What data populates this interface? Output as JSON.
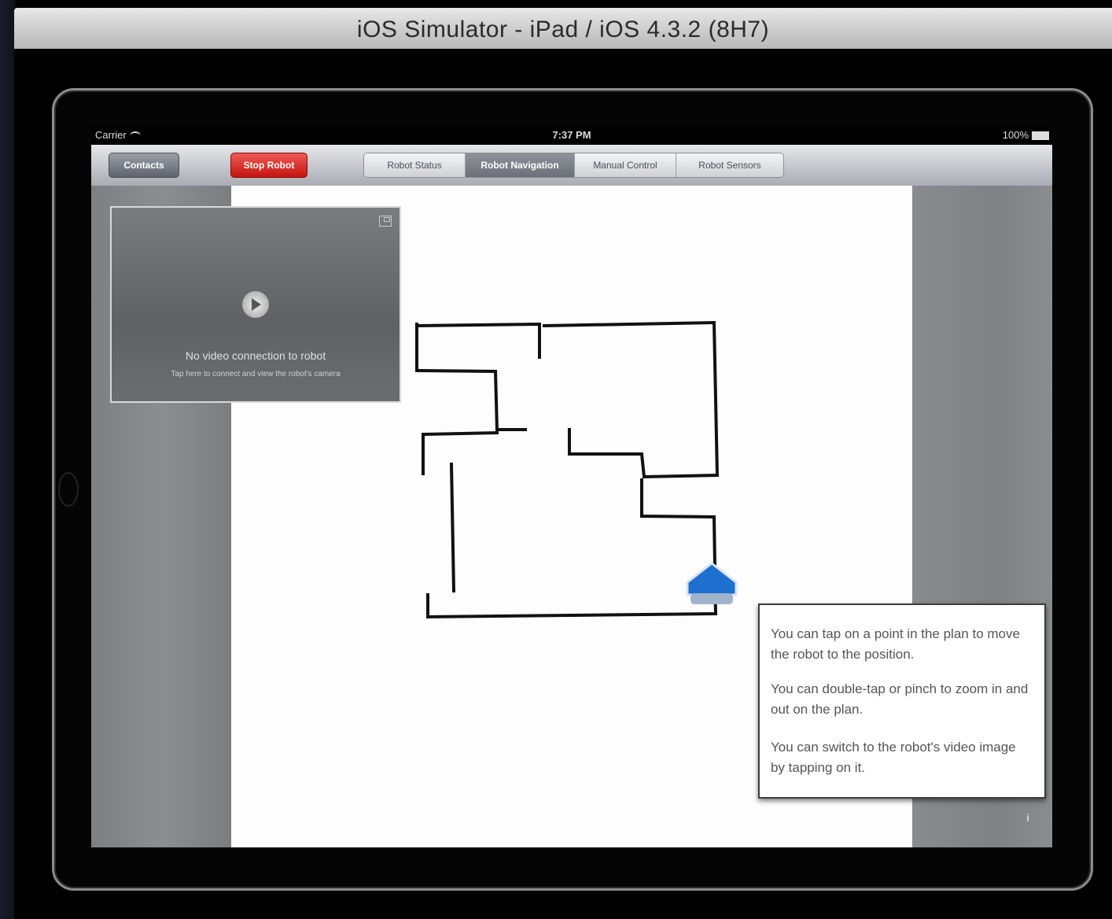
{
  "window": {
    "title": "iOS Simulator - iPad / iOS 4.3.2 (8H7)"
  },
  "statusbar": {
    "carrier": "Carrier",
    "time": "7:37 PM",
    "battery": "100%"
  },
  "navbar": {
    "contacts_label": "Contacts",
    "stop_label": "Stop Robot",
    "tabs": [
      {
        "label": "Robot Status",
        "active": false
      },
      {
        "label": "Robot Navigation",
        "active": true
      },
      {
        "label": "Manual Control",
        "active": false
      },
      {
        "label": "Robot Sensors",
        "active": false
      }
    ]
  },
  "video": {
    "message": "No video connection to robot",
    "hint": "Tap here to connect and view the robot's camera"
  },
  "help": {
    "p1": "You can tap on a point in the plan to move the robot to the position.",
    "p2": "You can double-tap or pinch to zoom in and out on the plan.",
    "p3": "You can switch to the robot's video image by tapping on it."
  },
  "info_button": "i",
  "colors": {
    "stop": "#d9231d",
    "robot": "#1f6fd0",
    "active_tab": "#7a7f87"
  }
}
